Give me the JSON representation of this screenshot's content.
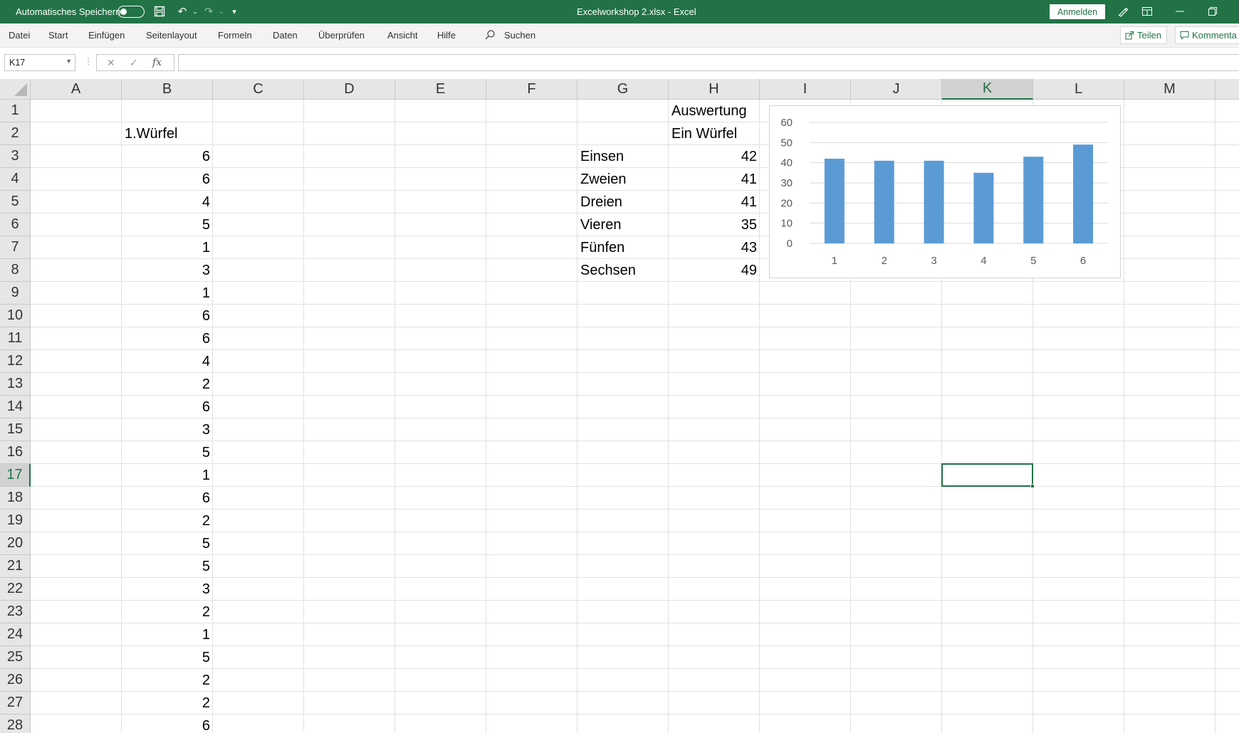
{
  "titlebar": {
    "autosave_label": "Automatisches Speichern",
    "document_title": "Excelworkshop 2.xlsx  -  Excel",
    "signin_label": "Anmelden",
    "background": "#217346"
  },
  "menu": {
    "items": [
      "Datei",
      "Start",
      "Einfügen",
      "Seitenlayout",
      "Formeln",
      "Daten",
      "Überprüfen",
      "Ansicht",
      "Hilfe"
    ],
    "search_label": "Suchen",
    "share_label": "Teilen",
    "comment_label": "Kommenta"
  },
  "formula_bar": {
    "name_box": "K17",
    "formula": ""
  },
  "sheet": {
    "columns": [
      "A",
      "B",
      "C",
      "D",
      "E",
      "F",
      "G",
      "H",
      "I",
      "J",
      "K",
      "L",
      "M"
    ],
    "selected_column": "K",
    "rows": [
      1,
      2,
      3,
      4,
      5,
      6,
      7,
      8,
      9,
      10,
      11,
      12,
      13,
      14,
      15,
      16,
      17,
      18,
      19,
      20,
      21,
      22,
      23,
      24,
      25,
      26,
      27,
      28
    ],
    "selected_row": 17,
    "active_cell": "K17",
    "column_b": {
      "header": "1.Würfel",
      "values": [
        6,
        6,
        4,
        5,
        1,
        3,
        1,
        6,
        6,
        4,
        2,
        6,
        3,
        5,
        1,
        6,
        2,
        5,
        5,
        3,
        2,
        1,
        5,
        2,
        2,
        6
      ]
    },
    "summary": {
      "title": "Auswertung",
      "subtitle": "Ein Würfel",
      "labels": [
        "Einsen",
        "Zweien",
        "Dreien",
        "Vieren",
        "Fünfen",
        "Sechsen"
      ],
      "counts": [
        42,
        41,
        41,
        35,
        43,
        49
      ]
    }
  },
  "chart_data": {
    "type": "bar",
    "categories": [
      "1",
      "2",
      "3",
      "4",
      "5",
      "6"
    ],
    "values": [
      42,
      41,
      41,
      35,
      43,
      49
    ],
    "ylim": [
      0,
      60
    ],
    "yticks": [
      0,
      10,
      20,
      30,
      40,
      50,
      60
    ],
    "grid": true,
    "bar_color": "#5b9bd5",
    "title": "",
    "xlabel": "",
    "ylabel": ""
  }
}
